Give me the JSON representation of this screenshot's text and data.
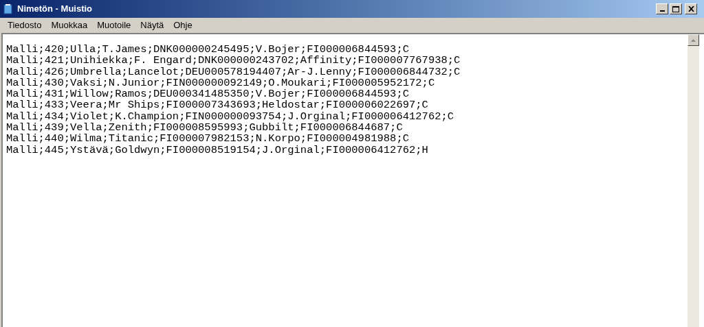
{
  "window": {
    "title": "Nimetön - Muistio"
  },
  "menu": [
    "Tiedosto",
    "Muokkaa",
    "Muotoile",
    "Näytä",
    "Ohje"
  ],
  "lines": [
    "Malli;420;Ulla;T.James;DNK000000245495;V.Bojer;FI000006844593;C",
    "Malli;421;Unihiekka;F. Engard;DNK000000243702;Affinity;FI000007767938;C",
    "Malli;426;Umbrella;Lancelot;DEU000578194407;Ar-J.Lenny;FI000006844732;C",
    "Malli;430;Vaksi;N.Junior;FIN000000092149;O.Moukari;FI000005952172;C",
    "Malli;431;Willow;Ramos;DEU000341485350;V.Bojer;FI000006844593;C",
    "Malli;433;Veera;Mr Ships;FI000007343693;Heldostar;FI000006022697;C",
    "Malli;434;Violet;K.Champion;FIN000000093754;J.Orginal;FI000006412762;C",
    "Malli;439;Vella;Zenith;FI000008595993;Gubbilt;FI000006844687;C",
    "Malli;440;Wilma;Titanic;FI000007982153;N.Korpo;FI000004981988;C",
    "Malli;445;Ystävä;Goldwyn;FI000008519154;J.Orginal;FI000006412762;H"
  ]
}
